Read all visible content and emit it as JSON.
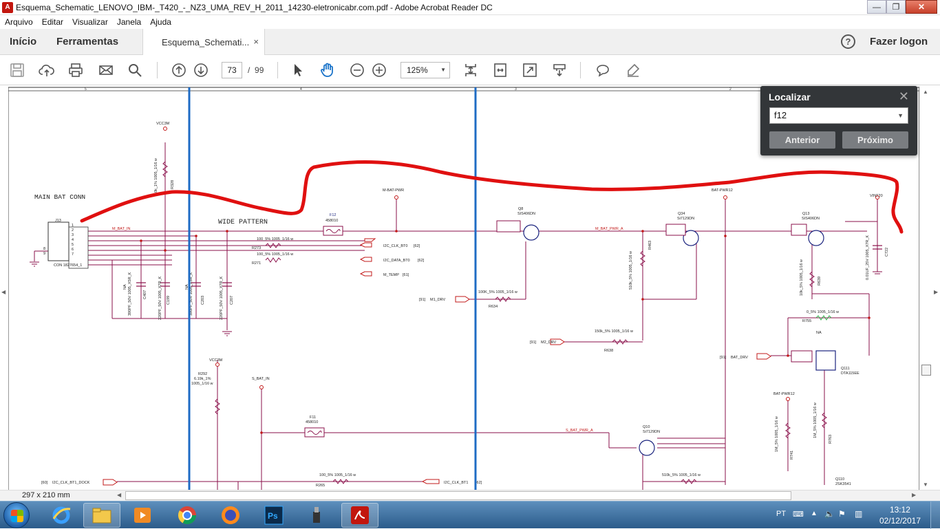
{
  "window": {
    "title": "Esquema_Schematic_LENOVO_IBM-_T420_-_NZ3_UMA_REV_H_2011_14230-eletronicabr.com.pdf - Adobe Acrobat Reader DC",
    "minimize": "—",
    "maximize": "❐",
    "close": "✕"
  },
  "menu": [
    "Arquivo",
    "Editar",
    "Visualizar",
    "Janela",
    "Ajuda"
  ],
  "nav": {
    "home": "Início",
    "tools": "Ferramentas",
    "tab_label": "Esquema_Schemati...",
    "tab_close": "×",
    "help": "?",
    "login": "Fazer logon"
  },
  "toolbar": {
    "page_current": "73",
    "page_sep": "/",
    "page_total": "99",
    "zoom": "125%"
  },
  "find": {
    "title": "Localizar",
    "query": "f12",
    "prev": "Anterior",
    "next": "Próximo",
    "close": "✕"
  },
  "status": {
    "page_size": "297 x 210 mm"
  },
  "taskbar": {
    "lang": "PT",
    "time": "13:12",
    "date": "02/12/2017"
  },
  "schematic": {
    "ruler": [
      "5",
      "4",
      "3",
      "2"
    ],
    "labels": {
      "main_bat_conn": "MAIN BAT CONN",
      "wide_pattern": "WIDE PATTERN",
      "vcc3m": "VCC3M",
      "vcc3m_2": "VCC3M",
      "m_bat_pwr": "M-BAT-PWR",
      "bat_pwr12": "BAT-PWR12",
      "bat_pwr12_2": "BAT-PWR12",
      "vint20": "VINT20",
      "j13": "J13",
      "con": "CON 1827654_1",
      "m_bat_in": "M_BAT_IN",
      "f12": "F12",
      "f12_val": "458010",
      "f11": "F11",
      "f11_val": "458010",
      "q8": "Q8",
      "q8_val": "SIS406DN",
      "q34": "Q34",
      "q34_val": "Si7129DN",
      "q13": "Q13",
      "q13_val": "SIS406DN",
      "q10": "Q10",
      "q10_val": "Si7129DN",
      "q111": "Q111",
      "q111_val": "DTA115EE",
      "q110": "Q110",
      "q110_val": "2SK3541",
      "m_bat_pwr_a": "M_BAT_PWR_A",
      "s_bat_pwr_a": "S_BAT_PWR_A",
      "s_bat_in": "S_BAT_IN",
      "i2c_clk": "I2C_CLK_BT0",
      "i2c_clk_ref": "[62]",
      "i2c_data": "I2C_DATA_BT0",
      "i2c_data_ref": "[62]",
      "m_temp": "M_TEMP",
      "m_temp_ref": "[61]",
      "m1_drv": "M1_DRV",
      "m1_drv_ref": "[91]",
      "m2_drv": "M2_DRV",
      "m2_drv_ref": "[91]",
      "bat_drv": "BAT_DRV",
      "bat_drv_ref": "[91]",
      "i2c_clk_bt1_dock": "I2C_CLK_BT1_DOCK",
      "i2c_clk_bt1_dock_ref": "[60]",
      "i2c_clk_bt1": "I2C_CLK_BT1",
      "i2c_clk_bt1_ref": "[62]",
      "r273": "R273",
      "r273_val": "100_5%  1005_1/16 w",
      "r271": "R271",
      "r271_val": "100_5%  1005_1/16 w",
      "r634": "R634",
      "r634_val": "100K_5% 1005_1/16 w",
      "r638": "R638",
      "r638_val": "150k_5% 1005_1/16 w",
      "r755": "R755",
      "r755_val": "0_5%    1005_1/16 w",
      "r292": "R292",
      "r292_val": "6.19k_1%",
      "r292_val2": "1005_1/16 w",
      "r265": "R265",
      "r265_val": "100_5%    1005_1/16 w",
      "r_bot": "510k_5%    1005_1/16 w",
      "na": "NA",
      "r328": "R328",
      "r328_val": "10k_1%    1005_1/16 w",
      "r463": "R463",
      "r463_val": "510k_5%    1005_1/16 w",
      "r639": "R639",
      "r639_val": "10k_5%    1005_1/16 w",
      "c722": "C722",
      "c722_val": "0.01UF_25V    1005_X7R_K",
      "r741": "R741",
      "r741_val": "1M_5%    1005_1/16 w",
      "r763": "R763",
      "r763_val": "1M_5%    1005_1/16 w",
      "c407": "C407",
      "c199": "C199",
      "c203": "C203",
      "c207": "C207",
      "c_val_a": "390PF_50V   1005_X5R_K",
      "c_val_b": "220PF_50V   1005_X7R_K",
      "pin1": "1",
      "pin2": "2",
      "pin3": "3",
      "pin4": "4",
      "pin5": "5",
      "pin6": "6",
      "pin7": "7",
      "pin8": "8",
      "pin9": "9"
    }
  }
}
